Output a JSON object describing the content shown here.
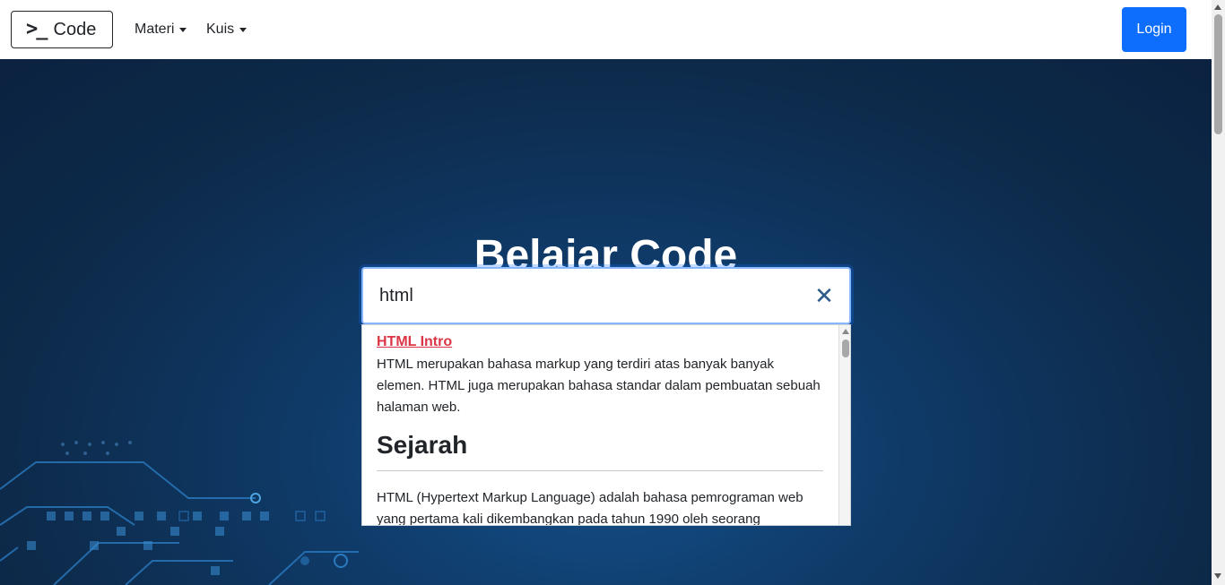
{
  "navbar": {
    "brand_glyph": ">_",
    "brand_text": "Code",
    "menu": [
      {
        "label": "Materi"
      },
      {
        "label": "Kuis"
      }
    ],
    "login_label": "Login"
  },
  "hero": {
    "title": "Belajar Code"
  },
  "search": {
    "value": "html",
    "clear_icon": "close-icon"
  },
  "results": {
    "link": "HTML Intro",
    "description": "HTML merupakan bahasa markup yang terdiri atas banyak banyak elemen. HTML juga merupakan bahasa standar dalam pembuatan sebuah halaman web.",
    "heading": "Sejarah",
    "paragraph": "HTML (Hypertext Markup Language) adalah bahasa pemrograman web yang pertama kali dikembangkan pada tahun 1990 oleh seorang"
  },
  "colors": {
    "primary": "#0d6efd",
    "link_red": "#dc3545",
    "hero_dark": "#0d2a4a"
  }
}
